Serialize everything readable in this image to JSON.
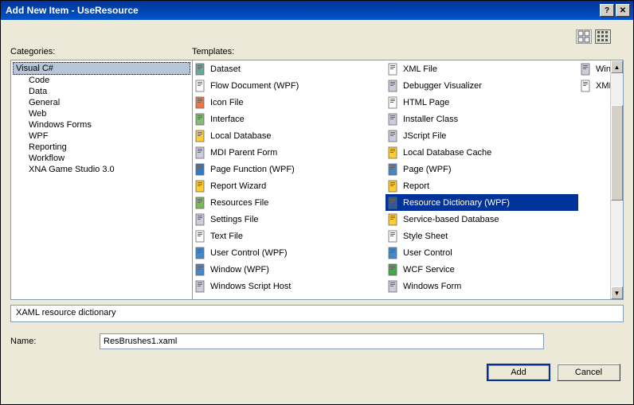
{
  "title": "Add New Item - UseResource",
  "labels": {
    "categories": "Categories:",
    "templates": "Templates:",
    "name": "Name:"
  },
  "categories": {
    "root": "Visual C#",
    "children": [
      "Code",
      "Data",
      "General",
      "Web",
      "Windows Forms",
      "WPF",
      "Reporting",
      "Workflow",
      "XNA Game Studio 3.0"
    ]
  },
  "templates_col1": [
    {
      "label": "Dataset",
      "icon": "dataset-icon"
    },
    {
      "label": "Flow Document (WPF)",
      "icon": "flowdoc-icon"
    },
    {
      "label": "Icon File",
      "icon": "icon-icon"
    },
    {
      "label": "Interface",
      "icon": "interface-icon"
    },
    {
      "label": "Local Database",
      "icon": "database-icon"
    },
    {
      "label": "MDI Parent Form",
      "icon": "form-icon"
    },
    {
      "label": "Page Function (WPF)",
      "icon": "pagefunc-icon"
    },
    {
      "label": "Report Wizard",
      "icon": "report-icon"
    },
    {
      "label": "Resources File",
      "icon": "resources-icon"
    },
    {
      "label": "Settings File",
      "icon": "settings-icon"
    },
    {
      "label": "Text File",
      "icon": "text-icon"
    },
    {
      "label": "User Control (WPF)",
      "icon": "usercontrol-icon"
    },
    {
      "label": "Window (WPF)",
      "icon": "window-icon"
    },
    {
      "label": "Windows Script Host",
      "icon": "script-icon"
    },
    {
      "label": "XML File",
      "icon": "xml-icon"
    }
  ],
  "templates_col2": [
    {
      "label": "Debugger Visualizer",
      "icon": "debugger-icon"
    },
    {
      "label": "HTML Page",
      "icon": "html-icon"
    },
    {
      "label": "Installer Class",
      "icon": "installer-icon"
    },
    {
      "label": "JScript File",
      "icon": "jscript-icon"
    },
    {
      "label": "Local Database Cache",
      "icon": "dbcache-icon"
    },
    {
      "label": "Page (WPF)",
      "icon": "page-icon"
    },
    {
      "label": "Report",
      "icon": "report-icon"
    },
    {
      "label": "Resource Dictionary (WPF)",
      "icon": "resdict-icon",
      "selected": true
    },
    {
      "label": "Service-based Database",
      "icon": "servicedb-icon"
    },
    {
      "label": "Style Sheet",
      "icon": "stylesheet-icon"
    },
    {
      "label": "User Control",
      "icon": "usercontrol-icon"
    },
    {
      "label": "WCF Service",
      "icon": "wcf-icon"
    },
    {
      "label": "Windows Form",
      "icon": "winform-icon"
    },
    {
      "label": "Windows Service",
      "icon": "winservice-icon"
    },
    {
      "label": "XML Schema",
      "icon": "xmlschema-icon"
    }
  ],
  "description": "XAML resource dictionary",
  "name_value": "ResBrushes1.xaml",
  "buttons": {
    "add": "Add",
    "cancel": "Cancel"
  }
}
